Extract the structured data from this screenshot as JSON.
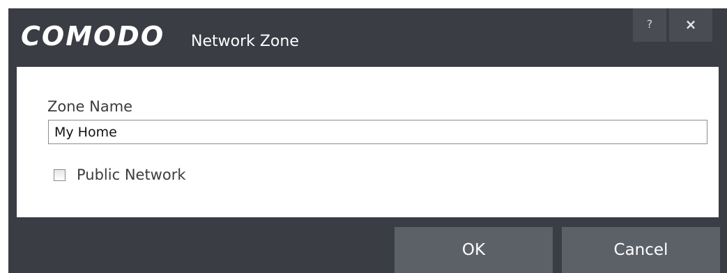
{
  "window": {
    "brand": "COMODO",
    "title": "Network Zone",
    "help_label": "?",
    "close_label": "×",
    "help_icon": "question-mark-icon",
    "close_icon": "close-icon"
  },
  "form": {
    "zone_name_label": "Zone Name",
    "zone_name_value": "My Home",
    "public_network_label": "Public Network",
    "public_network_checked": false
  },
  "footer": {
    "ok_label": "OK",
    "cancel_label": "Cancel"
  },
  "colors": {
    "titlebar": "#3a3d43",
    "title_buttons": "#494c53",
    "footer_buttons": "#5c6067",
    "content_bg": "#ffffff"
  }
}
